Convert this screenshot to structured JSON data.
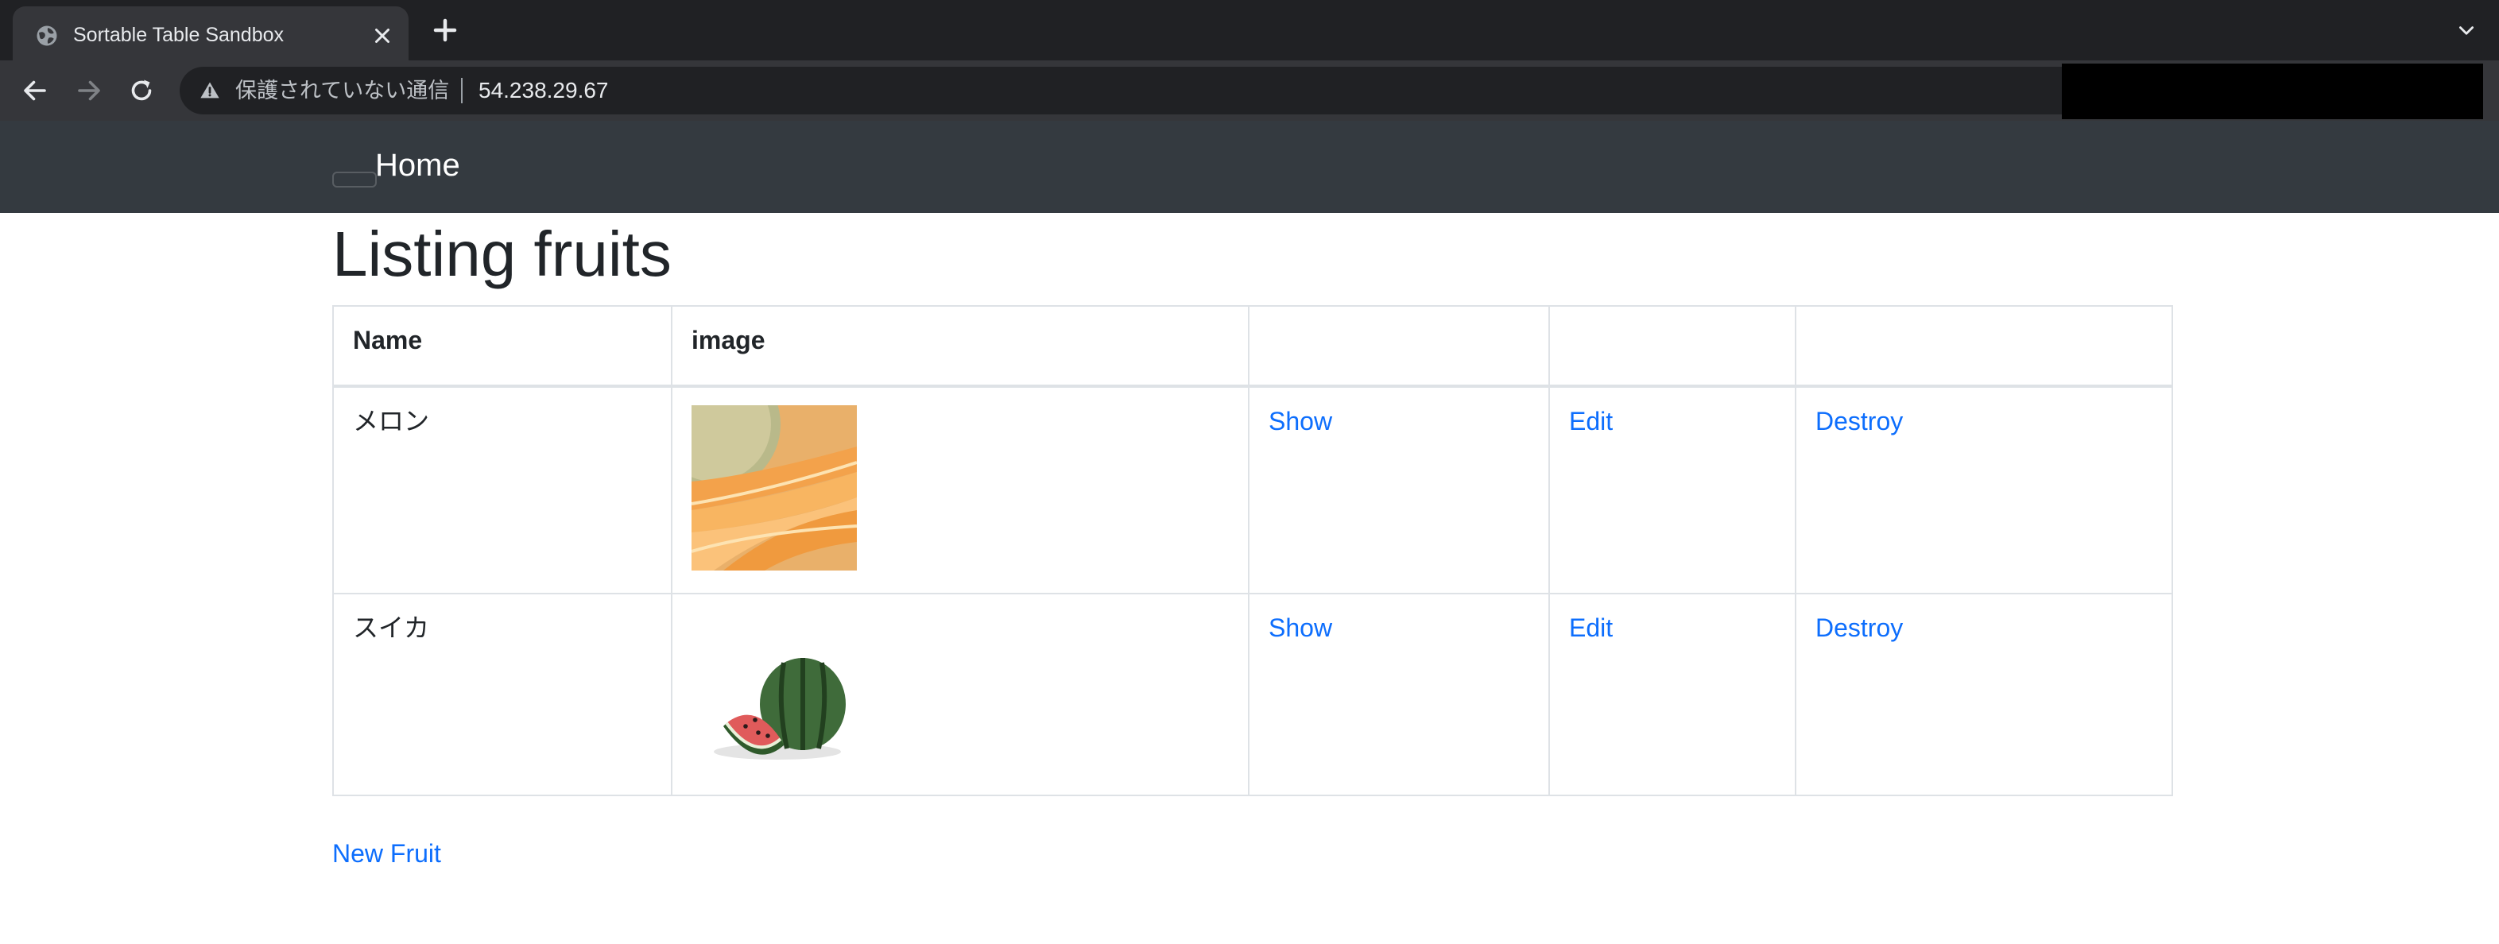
{
  "browser": {
    "tab_title": "Sortable Table Sandbox",
    "security_label": "保護されていない通信",
    "url": "54.238.29.67"
  },
  "navbar": {
    "home_label": "Home"
  },
  "page": {
    "heading": "Listing fruits",
    "new_link": "New Fruit"
  },
  "table": {
    "headers": [
      "Name",
      "image",
      "",
      "",
      ""
    ],
    "rows": [
      {
        "name": "メロン",
        "image_alt": "melon",
        "show": "Show",
        "edit": "Edit",
        "destroy": "Destroy"
      },
      {
        "name": "スイカ",
        "image_alt": "watermelon",
        "show": "Show",
        "edit": "Edit",
        "destroy": "Destroy"
      }
    ]
  },
  "colors": {
    "link": "#0d6efd",
    "navbar": "#343a40",
    "chrome_tabstrip": "#202124",
    "chrome_toolbar": "#35363a"
  },
  "icons": [
    "globe-icon",
    "close-icon",
    "plus-icon",
    "chevron-down-icon",
    "back-arrow-icon",
    "forward-arrow-icon",
    "reload-icon",
    "warning-icon"
  ]
}
